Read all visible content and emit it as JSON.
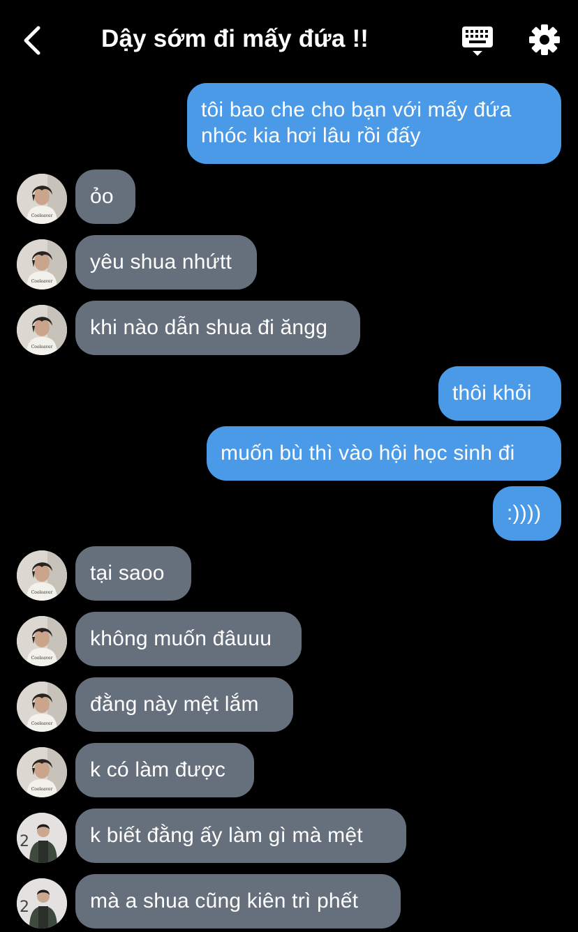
{
  "header": {
    "title": "Dậy sớm đi mấy đứa !!",
    "back_icon": "chevron-left-icon",
    "keyboard_icon": "keyboard-icon",
    "settings_icon": "gear-icon"
  },
  "colors": {
    "background": "#000000",
    "outgoing_bubble": "#4a9ae8",
    "incoming_bubble": "#66707d",
    "text": "#ffffff"
  },
  "messages": [
    {
      "side": "out",
      "text": "tôi bao che cho bạn với mấy đứa nhóc kia hơi lâu rồi đấy"
    },
    {
      "side": "in",
      "avatar": "avatar-a",
      "text": "ỏo"
    },
    {
      "side": "in",
      "avatar": "avatar-a",
      "text": "yêu shua nhứtt"
    },
    {
      "side": "in",
      "avatar": "avatar-a",
      "text": "khi nào dẫn shua đi ăngg"
    },
    {
      "side": "out",
      "text": "thôi khỏi"
    },
    {
      "side": "out",
      "text": "muốn bù thì vào hội học sinh đi"
    },
    {
      "side": "out",
      "text": ":))))"
    },
    {
      "side": "in",
      "avatar": "avatar-a",
      "text": "tại saoo"
    },
    {
      "side": "in",
      "avatar": "avatar-a",
      "text": "không muốn đâuuu"
    },
    {
      "side": "in",
      "avatar": "avatar-a",
      "text": "đằng này mệt lắm"
    },
    {
      "side": "in",
      "avatar": "avatar-a",
      "text": "k có làm được"
    },
    {
      "side": "in",
      "avatar": "avatar-b",
      "text": "k biết đằng ấy làm gì mà mệt"
    },
    {
      "side": "in",
      "avatar": "avatar-b",
      "text": "mà a shua cũng kiên trì phết"
    }
  ]
}
